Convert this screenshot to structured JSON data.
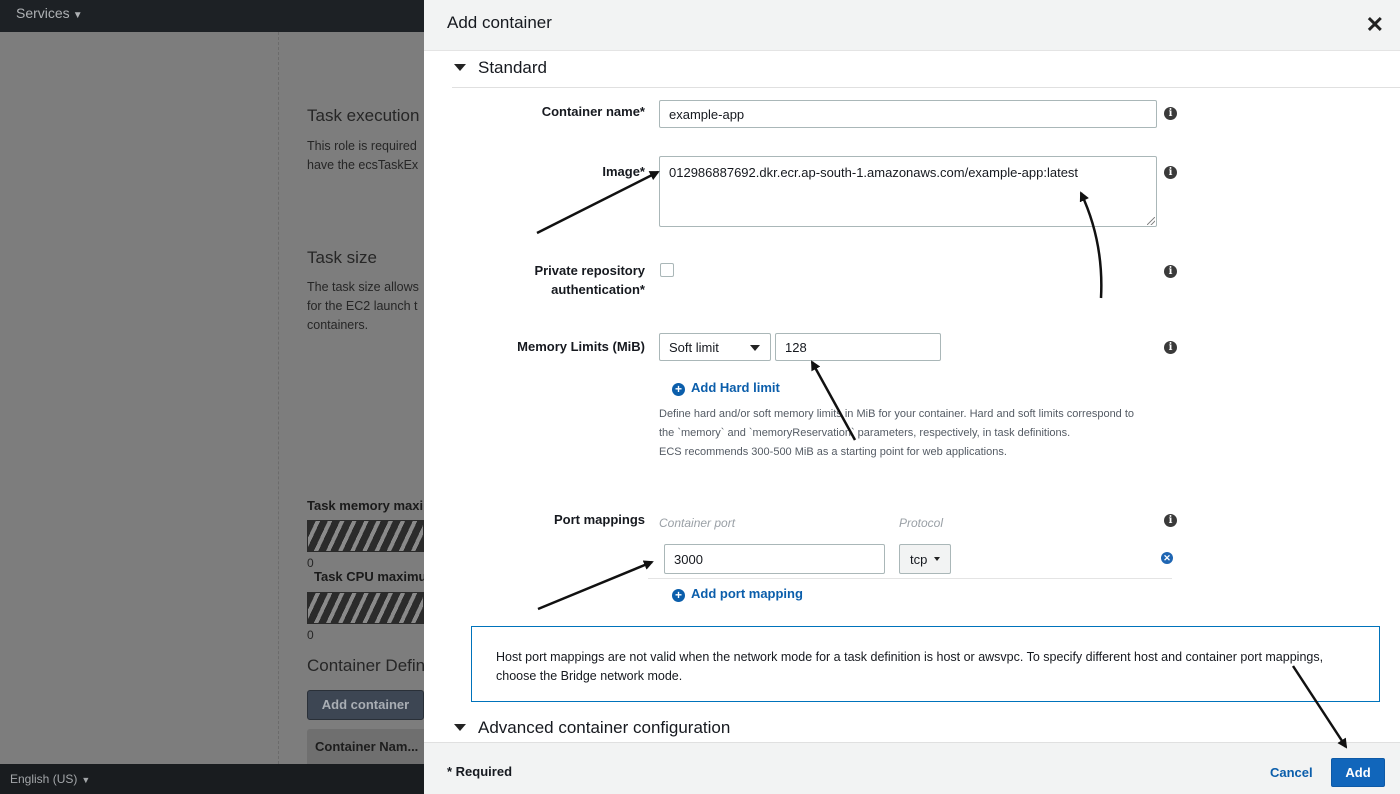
{
  "topbar": {
    "services_label": "Services"
  },
  "background_page": {
    "task_execution_heading": "Task execution",
    "task_execution_line1": "This role is required",
    "task_execution_line2": "have the ecsTaskEx",
    "task_size_heading": "Task size",
    "task_size_line1": "The task size allows",
    "task_size_line2": "for the EC2 launch t",
    "task_size_line3": "containers.",
    "task_memory_label": "Task memory maxi",
    "task_memory_value": "0",
    "task_cpu_label": "Task CPU maximu",
    "task_cpu_value": "0",
    "container_definitions_heading": "Container Defin",
    "add_container_button": "Add container",
    "container_name_column": "Container Nam..."
  },
  "footer_bar": {
    "language_label": "English (US)"
  },
  "modal": {
    "title": "Add container",
    "close_glyph": "✕",
    "standard_section": "Standard",
    "container_name": {
      "label": "Container name*",
      "value": "example-app"
    },
    "image": {
      "label": "Image*",
      "value": "012986887692.dkr.ecr.ap-south-1.amazonaws.com/example-app:latest"
    },
    "private_repo": {
      "label_line1": "Private repository",
      "label_line2": "authentication*",
      "checked": false
    },
    "memory": {
      "label": "Memory Limits (MiB)",
      "limit_type": "Soft limit",
      "value": "128",
      "add_hard_limit": "Add Hard limit",
      "help_line1": "Define hard and/or soft memory limits in MiB for your container. Hard and soft limits correspond to",
      "help_line2": "the `memory` and `memoryReservation` parameters, respectively, in task definitions.",
      "help_line3": "ECS recommends 300-500 MiB as a starting point for web applications."
    },
    "ports": {
      "label": "Port mappings",
      "container_port_header": "Container port",
      "protocol_header": "Protocol",
      "container_port_value": "3000",
      "protocol_value": "tcp",
      "add_port_mapping": "Add port mapping"
    },
    "alert_text": "Host port mappings are not valid when the network mode for a task definition is host or awsvpc. To specify different host and container port mappings, choose the Bridge network mode.",
    "advanced_section": "Advanced container configuration",
    "footer": {
      "required_note": "* Required",
      "cancel_label": "Cancel",
      "add_label": "Add"
    },
    "info_glyph": "i",
    "plus_glyph": "+",
    "remove_glyph": "✕"
  },
  "colors": {
    "accent": "#1166bb",
    "link": "#0b5eab",
    "alert_border": "#0073bb"
  }
}
